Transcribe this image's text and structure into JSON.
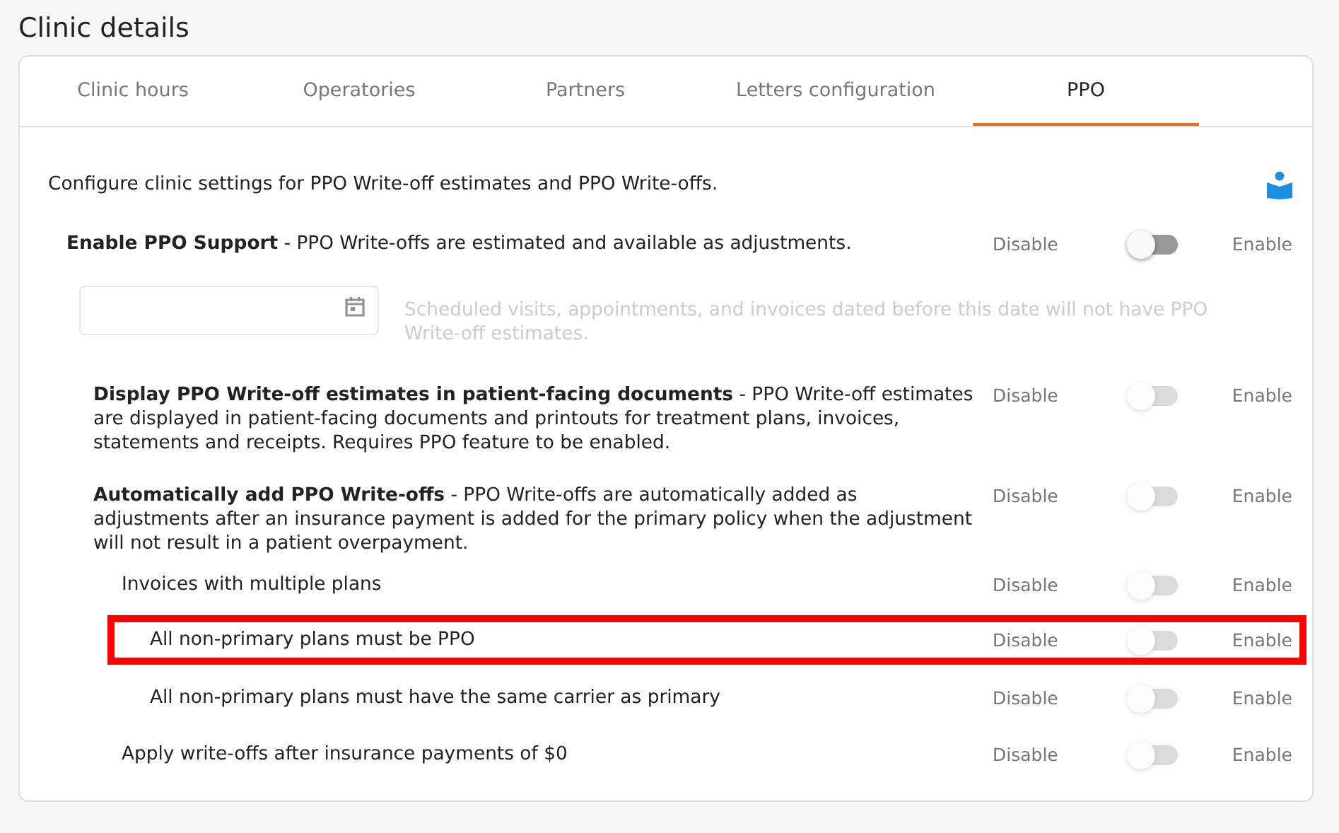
{
  "page_title": "Clinic details",
  "tabs": [
    {
      "label": "Clinic hours",
      "selected": false
    },
    {
      "label": "Operatories",
      "selected": false
    },
    {
      "label": "Partners",
      "selected": false
    },
    {
      "label": "Letters configuration",
      "selected": false
    },
    {
      "label": "PPO",
      "selected": true
    }
  ],
  "intro": "Configure clinic settings for PPO Write-off estimates and PPO Write-offs.",
  "settings": [
    {
      "description": "**Enable PPO Support** - PPO Write-offs are estimated and available as adjustments.",
      "off_label": "Disable",
      "on_label": "Enable",
      "on": false,
      "disabled": false,
      "highlighted": false,
      "date_field": {
        "disabled": true,
        "note": "Scheduled visits, appointments, and invoices dated before this date will not have PPO Write-off estimates."
      },
      "children": [
        {
          "description": "**Display PPO Write-off estimates in patient-facing documents** - PPO Write-off estimates are displayed in patient-facing documents and printouts for treatment plans, invoices, statements and receipts. Requires PPO feature to be enabled.",
          "off_label": "Disable",
          "on_label": "Enable",
          "on": false,
          "disabled": true,
          "highlighted": false
        },
        {
          "description": "**Automatically add PPO Write-offs** - PPO Write-offs are automatically added as adjustments after an insurance payment is added for the primary policy when the adjustment will not result in a patient overpayment.",
          "off_label": "Disable",
          "on_label": "Enable",
          "on": false,
          "disabled": true,
          "highlighted": false,
          "children": [
            {
              "description": "Invoices with multiple plans",
              "off_label": "Disable",
              "on_label": "Enable",
              "on": false,
              "disabled": true,
              "highlighted": false,
              "children": [
                {
                  "description": "All non-primary plans must be PPO",
                  "off_label": "Disable",
                  "on_label": "Enable",
                  "on": false,
                  "disabled": true,
                  "highlighted": true
                },
                {
                  "description": "All non-primary plans must have the same carrier as primary",
                  "off_label": "Disable",
                  "on_label": "Enable",
                  "on": false,
                  "disabled": true,
                  "highlighted": false
                }
              ]
            },
            {
              "description": "Apply write-offs after insurance payments of $0",
              "off_label": "Disable",
              "on_label": "Enable",
              "on": false,
              "disabled": true,
              "highlighted": false
            }
          ]
        }
      ]
    }
  ]
}
